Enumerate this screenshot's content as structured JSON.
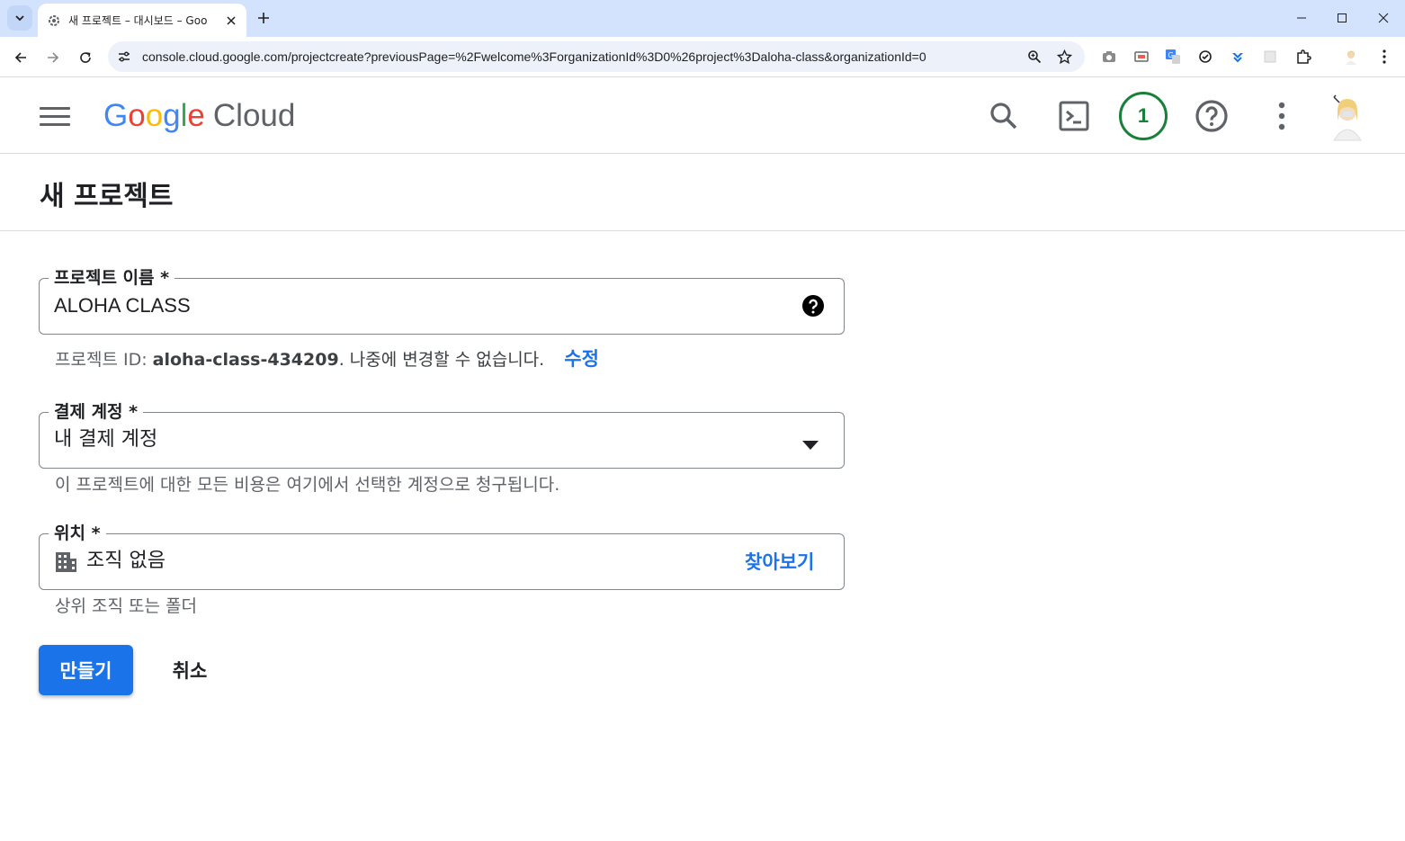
{
  "browser": {
    "tab_title": "새 프로젝트 – 대시보드 – Goo",
    "url": "console.cloud.google.com/projectcreate?previousPage=%2Fwelcome%3ForganizationId%3D0%26project%3Daloha-class&organizationId=0"
  },
  "header": {
    "logo_google": [
      "G",
      "o",
      "o",
      "g",
      "l",
      "e"
    ],
    "logo_colors": [
      "#4285F4",
      "#EA4335",
      "#FBBC05",
      "#4285F4",
      "#34A853",
      "#EA4335"
    ],
    "logo_cloud": "Cloud",
    "notification_count": "1"
  },
  "page": {
    "title": "새 프로젝트"
  },
  "form": {
    "project_name": {
      "label": "프로젝트 이름 *",
      "value": "ALOHA CLASS"
    },
    "project_id_helper": {
      "prefix": "프로젝트 ID: ",
      "id": "aloha-class-434209",
      "suffix": ". 나중에 변경할 수 없습니다.",
      "edit_link": "수정"
    },
    "billing_account": {
      "label": "결제 계정 *",
      "value": "내 결제 계정",
      "helper": "이 프로젝트에 대한 모든 비용은 여기에서 선택한 계정으로 청구됩니다."
    },
    "location": {
      "label": "위치 *",
      "value": "조직 없음",
      "browse_link": "찾아보기",
      "helper": "상위 조직 또는 폴더"
    }
  },
  "actions": {
    "create": "만들기",
    "cancel": "취소"
  },
  "colors": {
    "accent": "#1a73e8",
    "notification": "#188038",
    "tabstrip": "#d3e3fd"
  }
}
